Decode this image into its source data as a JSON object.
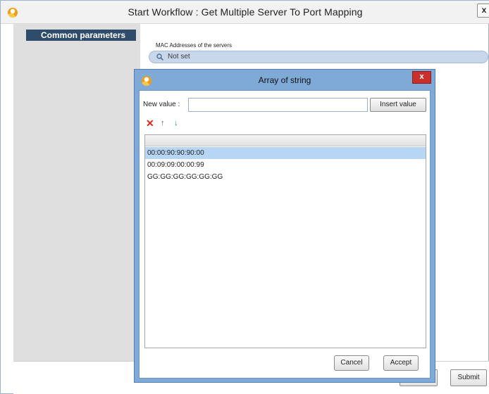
{
  "main": {
    "title": "Start Workflow : Get Multiple Server To Port Mapping",
    "close_label": "x",
    "section_header": "Common parameters",
    "field": {
      "label": "MAC Addresses of the servers",
      "value": "Not set",
      "icon": "magnifier-icon"
    },
    "buttons": {
      "submit": "Submit"
    }
  },
  "dialog": {
    "title": "Array of string",
    "close_label": "x",
    "new_value_label": "New value :",
    "new_value_input": "",
    "insert_button": "Insert value",
    "toolbar": {
      "delete_icon": "✕",
      "up_icon": "↑",
      "down_icon": "↓"
    },
    "items": [
      {
        "value": "00:00:90:90:90:00",
        "selected": true
      },
      {
        "value": "00:09:09:00:00:99",
        "selected": false
      },
      {
        "value": "GG:GG:GG:GG:GG:GG",
        "selected": false
      }
    ],
    "buttons": {
      "cancel": "Cancel",
      "accept": "Accept"
    }
  },
  "colors": {
    "dialog_frame": "#7fa9d6",
    "section_header": "#2f4d6b",
    "selected_row": "#b7d6f5",
    "close_button": "#c9302c"
  }
}
